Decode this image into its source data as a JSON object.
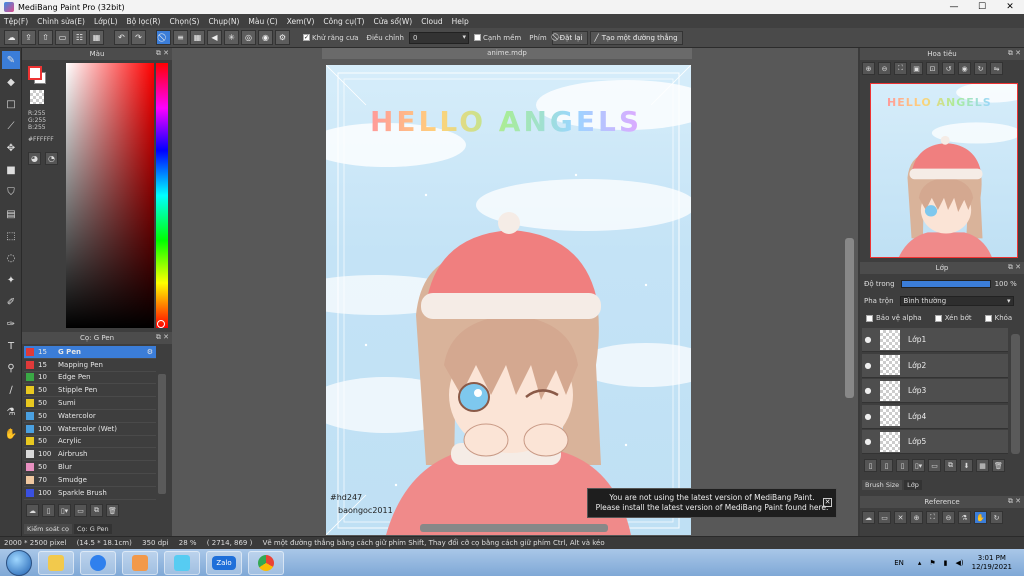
{
  "window": {
    "title": "MediBang Paint Pro (32bit)",
    "minimize": "—",
    "maximize": "☐",
    "close": "✕"
  },
  "menu": [
    "Tệp(F)",
    "Chỉnh sửa(E)",
    "Lớp(L)",
    "Bộ lọc(R)",
    "Chọn(S)",
    "Chụp(N)",
    "Màu (C)",
    "Xem(V)",
    "Công cụ(T)",
    "Cửa sổ(W)",
    "Cloud",
    "Help"
  ],
  "toolbar": {
    "antialias_label": "Khử răng cưa",
    "correction_label": "Điều chỉnh",
    "correction_value": "0",
    "edge_label": "Cạnh mềm",
    "key_label": "Phím",
    "reset_label": "Đặt lại",
    "straight_line_label": "Tạo một đường thẳng"
  },
  "color_panel": {
    "title": "Màu",
    "r": "R:255",
    "g": "G:255",
    "b": "B:255",
    "hex": "#FFFFFF"
  },
  "brush_panel": {
    "title": "Cọ: G Pen",
    "brushes": [
      {
        "size": "15",
        "name": "G Pen",
        "color": "#e03a3a",
        "selected": true
      },
      {
        "size": "15",
        "name": "Mapping Pen",
        "color": "#e03a3a"
      },
      {
        "size": "10",
        "name": "Edge Pen",
        "color": "#3aa845"
      },
      {
        "size": "50",
        "name": "Stipple Pen",
        "color": "#e8c820"
      },
      {
        "size": "50",
        "name": "Sumi",
        "color": "#e8c820"
      },
      {
        "size": "50",
        "name": "Watercolor",
        "color": "#4aa0e0"
      },
      {
        "size": "100",
        "name": "Watercolor (Wet)",
        "color": "#4aa0e0"
      },
      {
        "size": "50",
        "name": "Acrylic",
        "color": "#e8c820"
      },
      {
        "size": "100",
        "name": "Airbrush",
        "color": "#d8d8d8"
      },
      {
        "size": "50",
        "name": "Blur",
        "color": "#e890c0"
      },
      {
        "size": "70",
        "name": "Smudge",
        "color": "#f0c8a0"
      },
      {
        "size": "100",
        "name": "Sparkle Brush",
        "color": "#3a50e0"
      }
    ],
    "tab_left": "Kiểm soát cọ",
    "tab_right": "Cọ: G Pen"
  },
  "canvas": {
    "doc_tab": "anime.mdp",
    "art_title": "HELLO ANGELS",
    "signature_tag": "#hd247",
    "signature_name": "baongoc2011"
  },
  "notice": {
    "line1": "You are not using the latest version of MediBang Paint.",
    "line2": "Please install the latest version of MediBang Paint found here."
  },
  "navigator": {
    "title": "Hoa tiêu"
  },
  "layers": {
    "title": "Lớp",
    "opacity_label": "Độ trong",
    "opacity_value": "100 %",
    "opacity_fraction": 1.0,
    "blend_label": "Pha trộn",
    "blend_value": "Bình thường",
    "protect_alpha": "Bảo vệ alpha",
    "clipping": "Xén bớt",
    "lock": "Khóa",
    "items": [
      "Lớp1",
      "Lớp2",
      "Lớp3",
      "Lớp4",
      "Lớp5"
    ],
    "tab_left": "Brush Size",
    "tab_right": "Lớp"
  },
  "reference": {
    "title": "Reference"
  },
  "status": {
    "size": "2000 * 2500 pixel",
    "physical": "(14.5 * 18.1cm)",
    "dpi": "350 dpi",
    "zoom": "28 %",
    "coords": "( 2714, 869 )",
    "hint": "Vẽ một đường thẳng bằng cách giữ phím Shift, Thay đổi cỡ cọ bằng cách giữ phím Ctrl, Alt và kéo"
  },
  "taskbar": {
    "zalo": "Zalo",
    "lang": "EN",
    "time": "3:01 PM",
    "date": "12/19/2021"
  },
  "colors": {
    "accent": "#3b7dd8",
    "panel": "#3e3e3e",
    "canvas_bg": "#585858"
  }
}
